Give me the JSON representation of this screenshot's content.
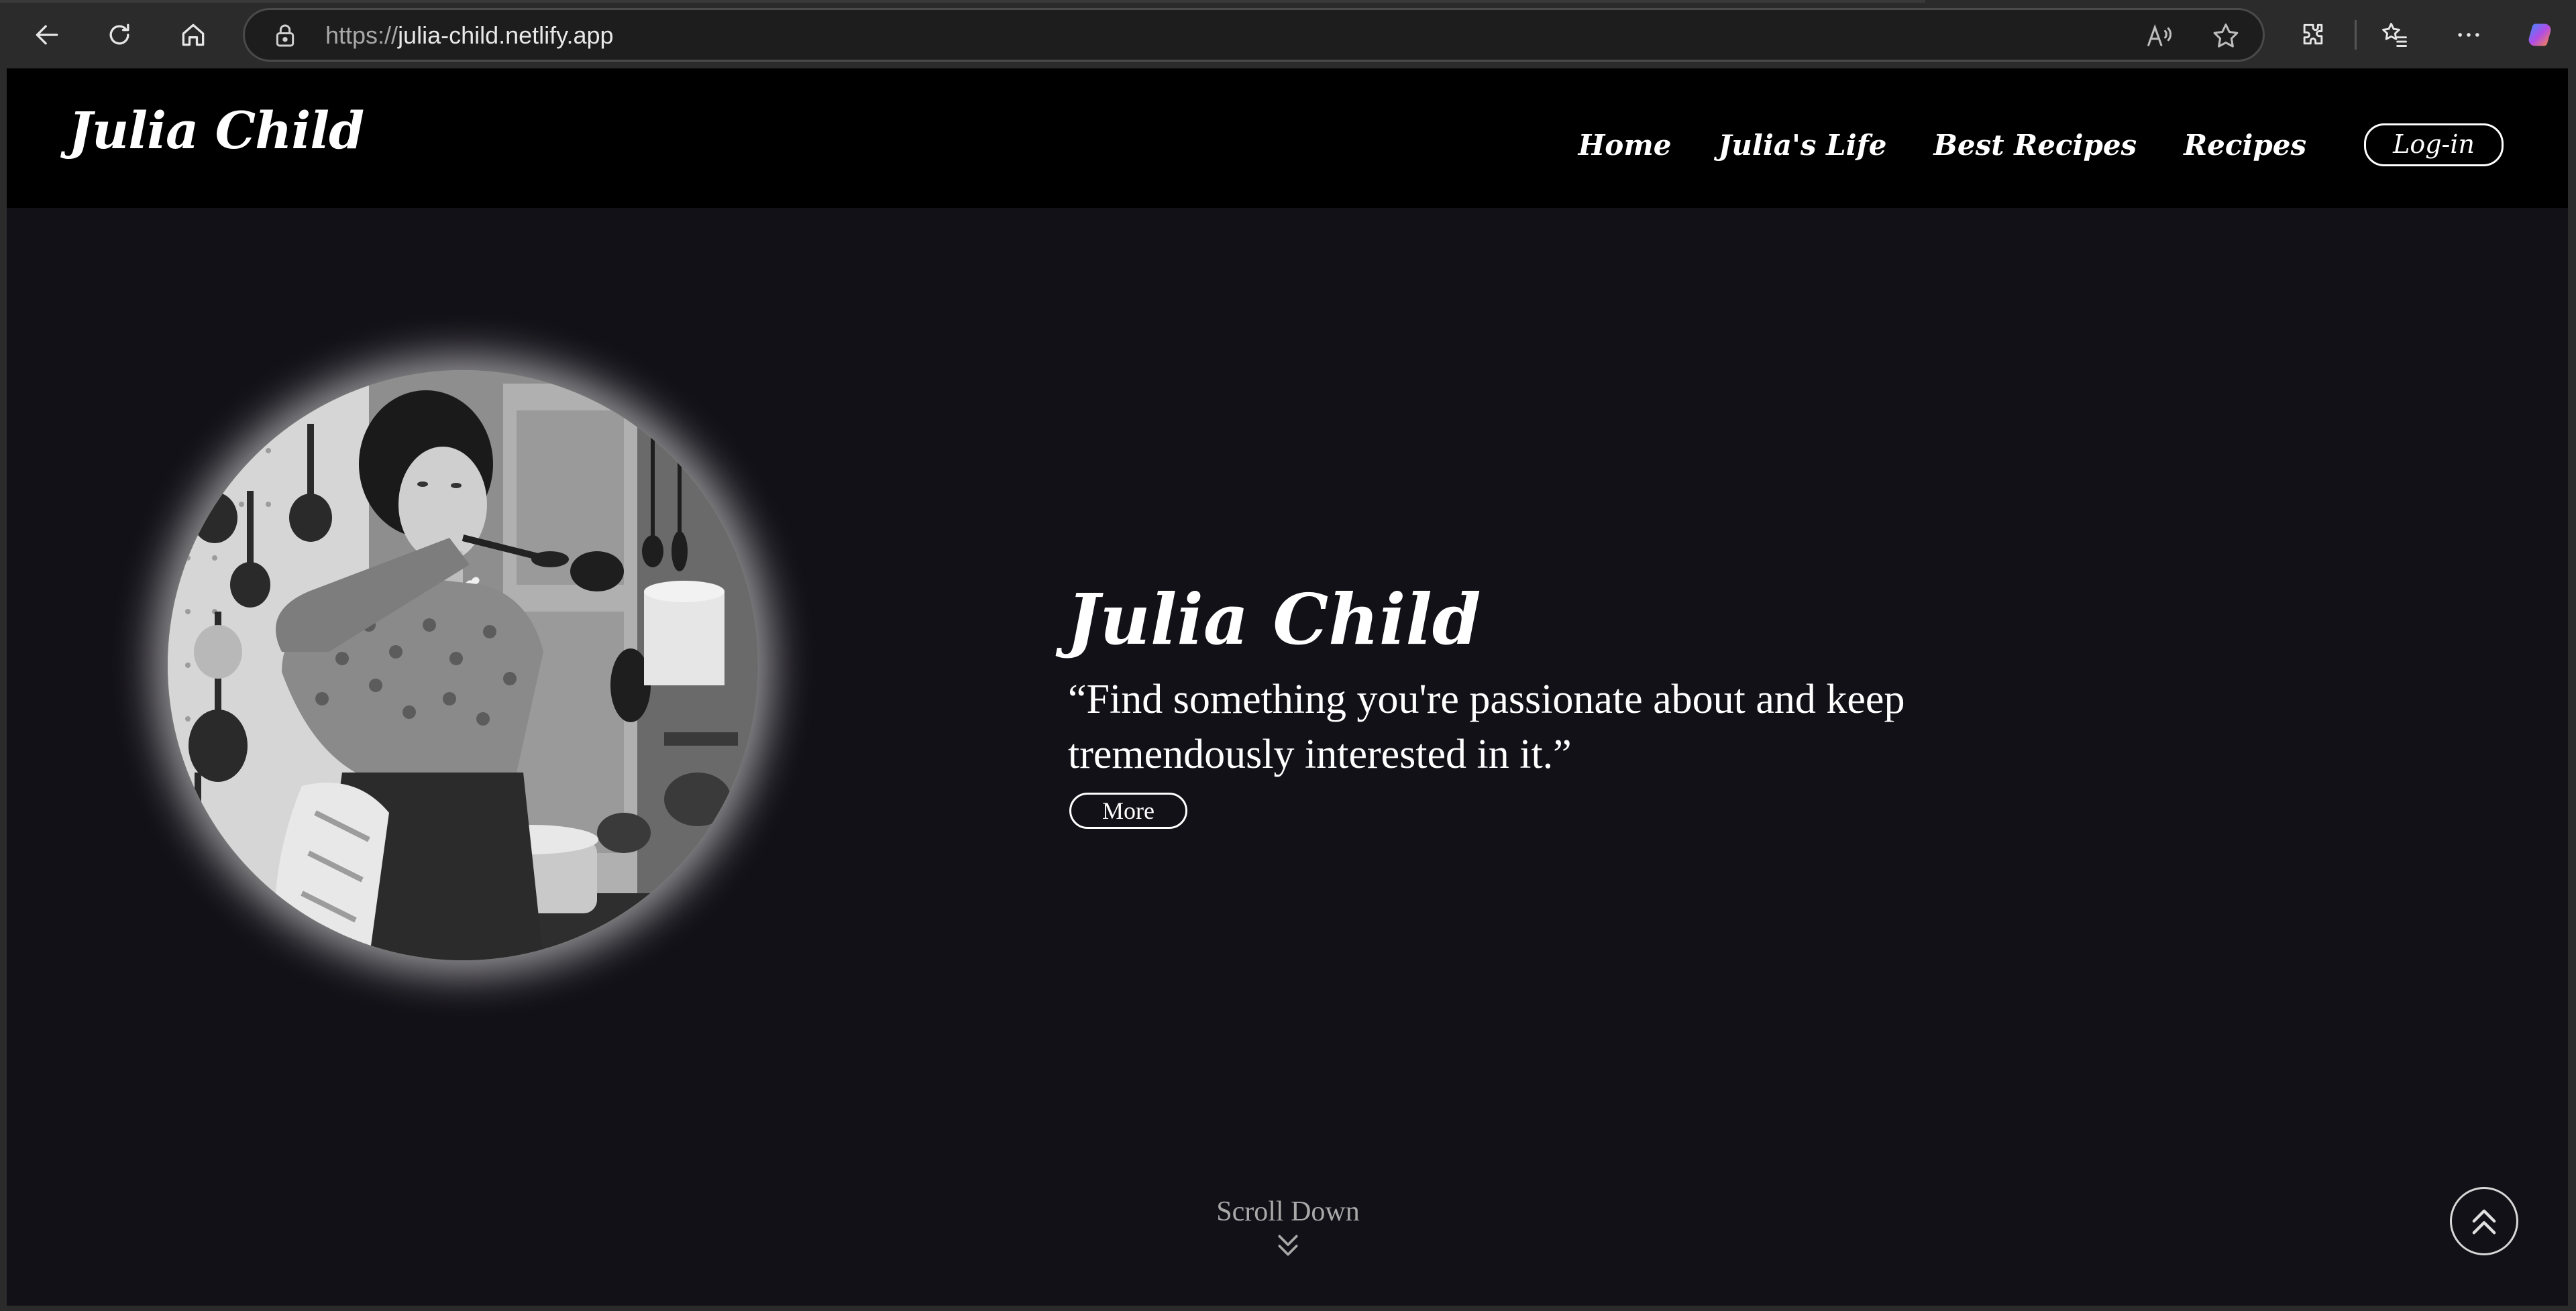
{
  "browser": {
    "url_scheme": "https://",
    "url_host": "julia-child.netlify.app",
    "icons": {
      "back": "back-arrow-icon",
      "refresh": "refresh-icon",
      "home": "home-icon",
      "lock": "lock-icon",
      "read_aloud": "read-aloud-icon",
      "favorite": "star-icon",
      "extensions": "puzzle-icon",
      "favorites_list": "favorites-icon",
      "more": "ellipsis-icon",
      "copilot": "copilot-icon"
    }
  },
  "site": {
    "logo": "Julia Child",
    "nav": {
      "home": "Home",
      "life": "Julia's Life",
      "best_recipes": "Best Recipes",
      "recipes": "Recipes",
      "login": "Log-in"
    }
  },
  "hero": {
    "title": "Julia Child",
    "quote": "“Find something you're passionate about and keep tremendously interested in it.”",
    "more_label": "More"
  },
  "scroll": {
    "label": "Scroll Down"
  },
  "colors": {
    "page_background": "#121117",
    "header_background": "#000000",
    "text": "#ffffff",
    "muted_text": "#a9a9a9"
  }
}
